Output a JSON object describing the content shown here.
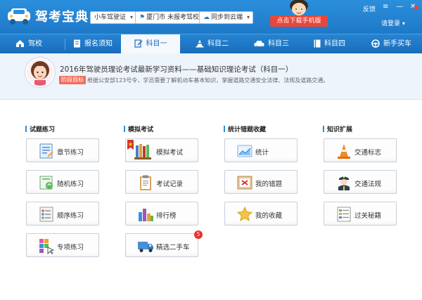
{
  "app": {
    "title": "驾考宝典"
  },
  "header": {
    "vehicle_select": "小车驾驶证",
    "city_select": "厦门市 未报考驾校",
    "sync_select": "同步到云端",
    "download_button": "点击下载手机版",
    "feedback": "反馈",
    "login": "请登录"
  },
  "nav": {
    "items": [
      {
        "label": "驾校",
        "icon": "school-icon"
      },
      {
        "label": "报名须知",
        "icon": "notice-icon"
      },
      {
        "label": "科目一",
        "icon": "edit-icon",
        "active": true
      },
      {
        "label": "科目二",
        "icon": "cone-icon"
      },
      {
        "label": "科目三",
        "icon": "car-icon"
      },
      {
        "label": "科目四",
        "icon": "book-icon"
      },
      {
        "label": "新手买车",
        "icon": "steering-icon"
      }
    ]
  },
  "banner": {
    "title": "2016年驾驶员理论考试最新学习资料——基础知识理论考试（科目一）",
    "badge": "阶段目标",
    "description": "根据公安部123号令，学员需要了解机动车基本知识，掌握道路交通安全法律、法规及道路交通。"
  },
  "sections": [
    {
      "title": "试题练习",
      "tiles": [
        "章节练习",
        "随机练习",
        "顺序练习",
        "专项练习"
      ]
    },
    {
      "title": "模拟考试",
      "tiles": [
        "模拟考试",
        "考试记录",
        "排行榜",
        "精选二手车"
      ]
    },
    {
      "title": "统计错题收藏",
      "tiles": [
        "统计",
        "我的错题",
        "我的收藏"
      ]
    },
    {
      "title": "知识扩展",
      "tiles": [
        "交通标志",
        "交通法规",
        "过关秘籍"
      ]
    }
  ],
  "badges": {
    "used_car": "5"
  },
  "colors": {
    "primary": "#1e79c7",
    "download": "#e8463b",
    "badge": "#e8322c"
  }
}
